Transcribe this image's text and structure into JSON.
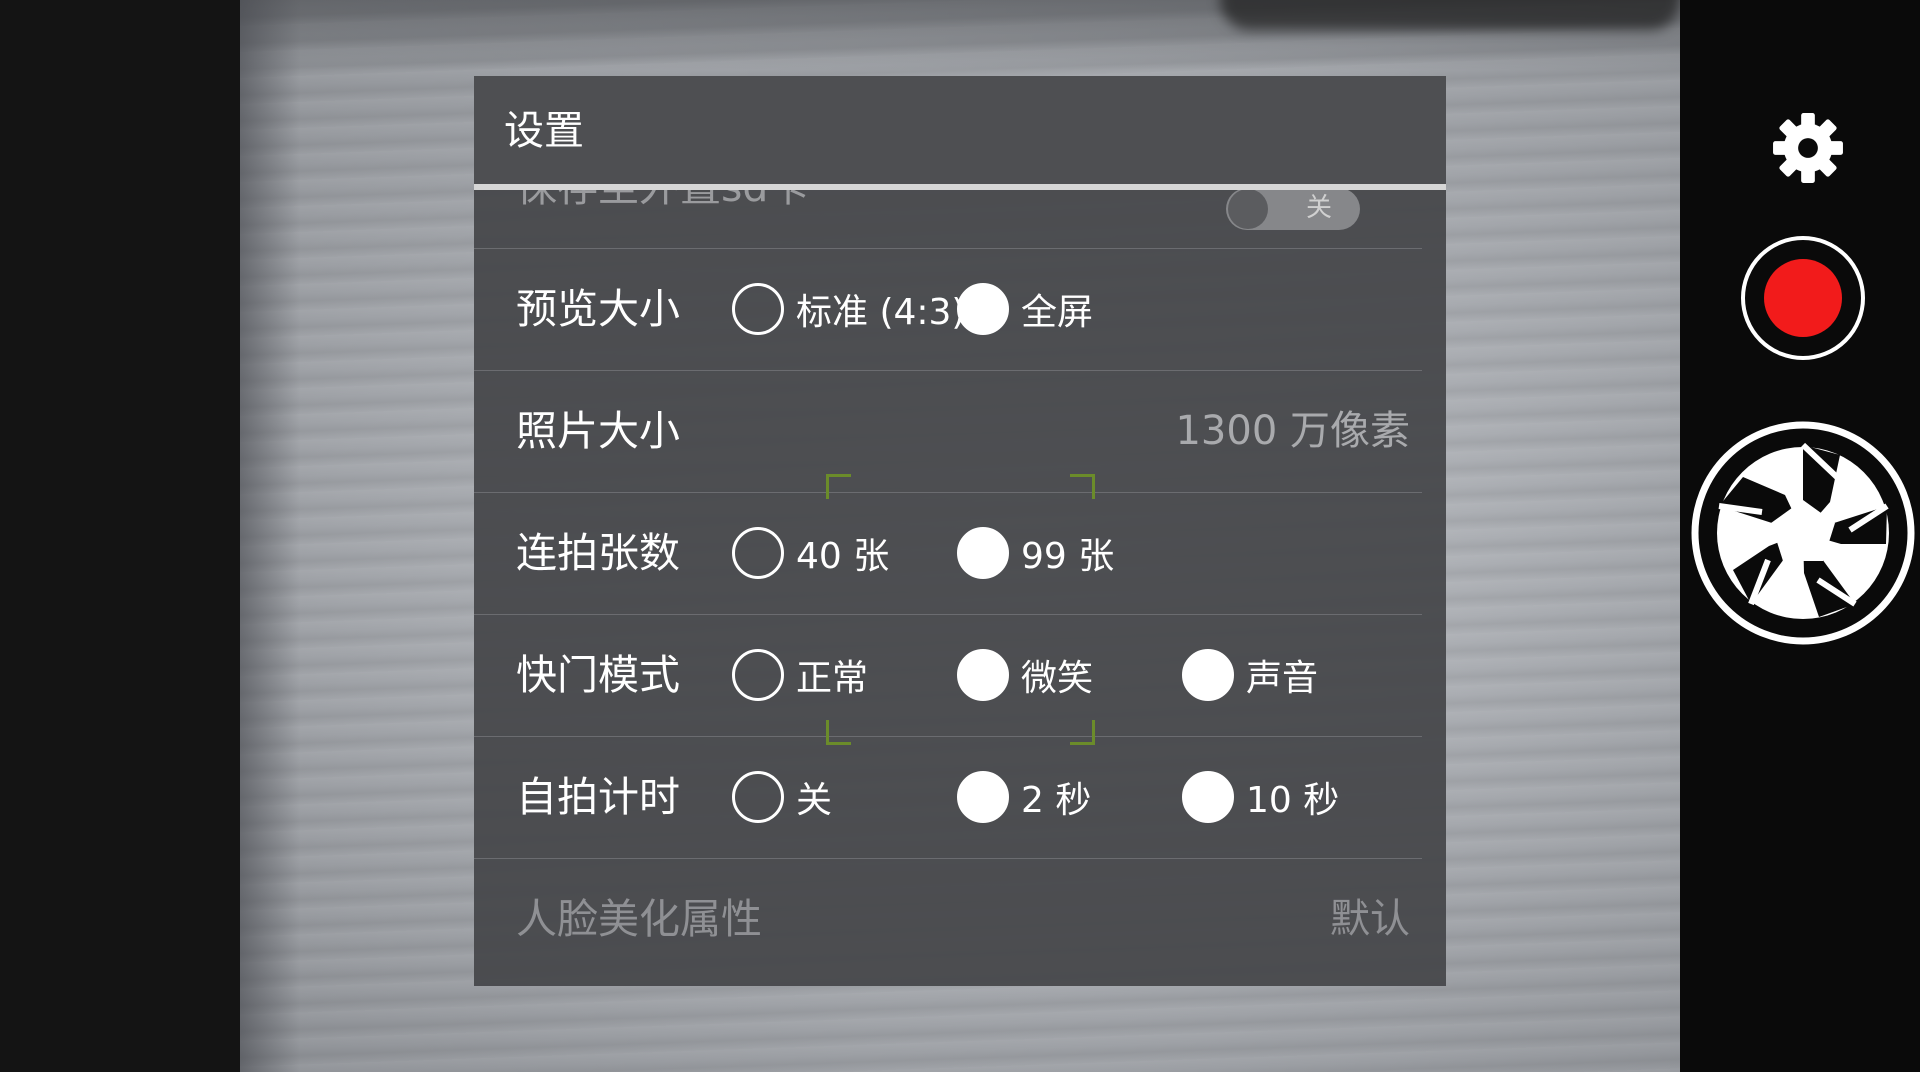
{
  "dialog": {
    "title": "设置",
    "rows": [
      {
        "id": "save-location",
        "label": "保存至外置sd卡",
        "toggle_text": "关"
      },
      {
        "id": "preview-size",
        "label": "预览大小",
        "options": [
          {
            "label": "标准 (4:3)",
            "selected": false
          },
          {
            "label": "全屏",
            "selected": true
          }
        ]
      },
      {
        "id": "photo-size",
        "label": "照片大小",
        "value": "1300 万像素"
      },
      {
        "id": "burst-count",
        "label": "连拍张数",
        "options": [
          {
            "label": "40 张",
            "selected": false
          },
          {
            "label": "99 张",
            "selected": true
          }
        ]
      },
      {
        "id": "shutter-mode",
        "label": "快门模式",
        "options": [
          {
            "label": "正常",
            "selected": false
          },
          {
            "label": "微笑",
            "selected": true
          },
          {
            "label": "声音",
            "selected": true
          }
        ]
      },
      {
        "id": "self-timer",
        "label": "自拍计时",
        "options": [
          {
            "label": "关",
            "selected": false
          },
          {
            "label": "2 秒",
            "selected": true
          },
          {
            "label": "10 秒",
            "selected": true
          }
        ]
      },
      {
        "id": "face-beauty",
        "label": "人脸美化属性",
        "value": "默认"
      }
    ]
  },
  "controls": {
    "settings_icon": "gear-icon",
    "record_icon": "record-icon",
    "shutter_icon": "shutter-aperture-icon",
    "record_color": "#f21b1b"
  }
}
